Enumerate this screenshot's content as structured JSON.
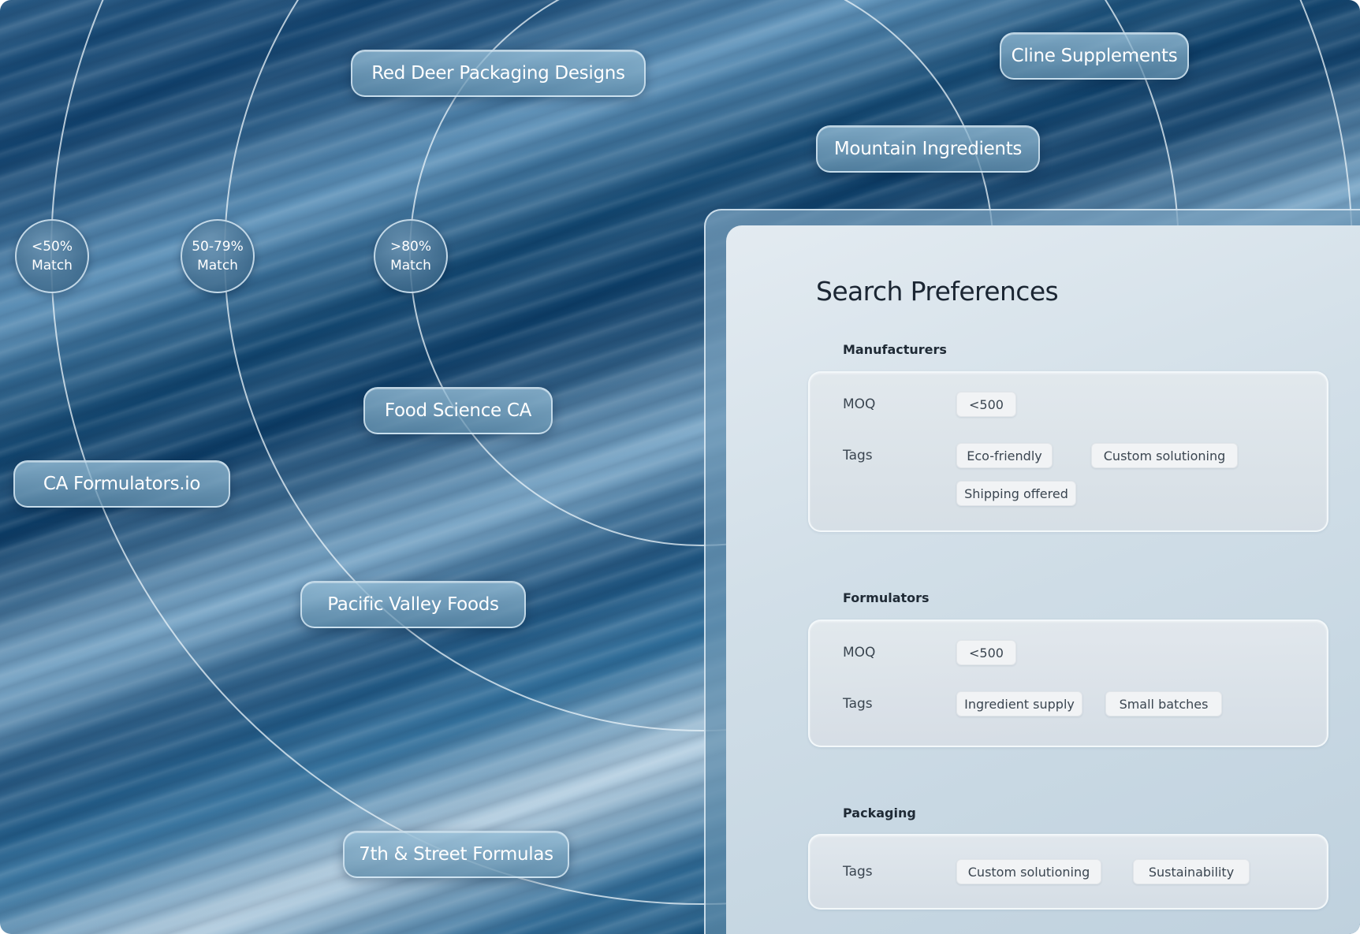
{
  "rings": {
    "low_match": [
      "<50%",
      "Match"
    ],
    "mid_match": [
      "50-79%",
      "Match"
    ],
    "high_match": [
      ">80%",
      "Match"
    ]
  },
  "suppliers": [
    "Red Deer Packaging Designs",
    "Cline Supplements",
    "Mountain Ingredients",
    "Food Science CA",
    "CA Formulators.io",
    "Pacific Valley Foods",
    "7th & Street Formulas"
  ],
  "panel": {
    "title": "Search Preferences",
    "sections": [
      {
        "label": "Manufacturers",
        "rows": [
          {
            "label": "MOQ",
            "chips": [
              "<500"
            ]
          },
          {
            "label": "Tags",
            "chips": [
              "Eco-friendly",
              "Custom solutioning",
              "Shipping offered"
            ]
          }
        ]
      },
      {
        "label": "Formulators",
        "rows": [
          {
            "label": "MOQ",
            "chips": [
              "<500"
            ]
          },
          {
            "label": "Tags",
            "chips": [
              "Ingredient supply",
              "Small batches"
            ]
          }
        ]
      },
      {
        "label": "Packaging",
        "rows": [
          {
            "label": "Tags",
            "chips": [
              "Custom solutioning",
              "Sustainability"
            ]
          }
        ]
      }
    ]
  }
}
